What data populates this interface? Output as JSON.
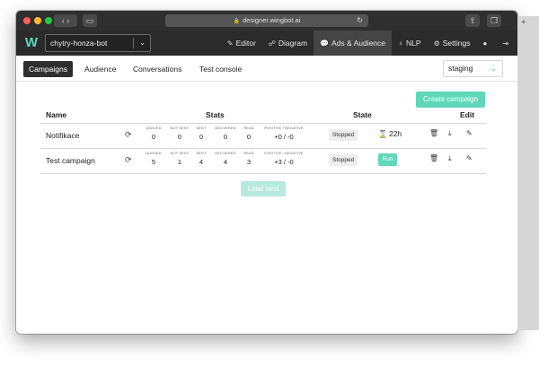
{
  "browser": {
    "url": "designer.wingbot.ai",
    "traffic_colors": [
      "#ff5f57",
      "#febc2e",
      "#28c840"
    ]
  },
  "app": {
    "logo": "W",
    "bot_selector": "chytry-honza-bot",
    "nav": [
      {
        "icon": "pencil-icon",
        "label": "Editor"
      },
      {
        "icon": "diagram-icon",
        "label": "Diagram"
      },
      {
        "icon": "chat-icon",
        "label": "Ads & Audience"
      },
      {
        "icon": "bulb-icon",
        "label": "NLP"
      },
      {
        "icon": "gears-icon",
        "label": "Settings"
      }
    ]
  },
  "tabs": [
    "Campaigns",
    "Audience",
    "Conversations",
    "Test console"
  ],
  "environment": "staging",
  "create_button": "Create campaign",
  "table": {
    "headers": {
      "name": "Name",
      "stats": "Stats",
      "state": "State",
      "edit": "Edit"
    },
    "stat_labels": [
      "QUEUED",
      "NOT SENT",
      "SENT",
      "DELIVERED",
      "READ",
      "POSITIVE / NEGATIVE"
    ],
    "rows": [
      {
        "name": "Notifikace",
        "stats": [
          "0",
          "0",
          "0",
          "0",
          "0",
          "+0 / -0"
        ],
        "status": "Stopped",
        "extra": "22h"
      },
      {
        "name": "Test campaign",
        "stats": [
          "5",
          "1",
          "4",
          "4",
          "3",
          "+3 / -0"
        ],
        "status": "Stopped",
        "run": "Run"
      }
    ]
  },
  "load_next": "Load next",
  "accent_color": "#5fd7b8"
}
